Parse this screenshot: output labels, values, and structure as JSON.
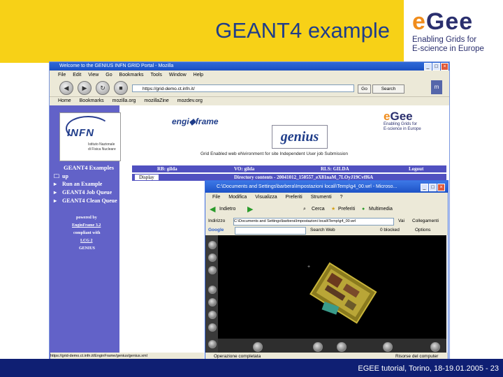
{
  "slide": {
    "title": "GEANT4 example",
    "footer": "EGEE tutorial, Torino, 18-19.01.2005  -  23",
    "logo_word": "eGee",
    "logo_tag_1": "Enabling Grids for",
    "logo_tag_2": "E-science in Europe"
  },
  "browser": {
    "title": "Welcome to the GENIUS INFN GRID Portal - Mozilla",
    "menu": [
      "File",
      "Edit",
      "View",
      "Go",
      "Bookmarks",
      "Tools",
      "Window",
      "Help"
    ],
    "url": "https://grid-demo.ct.infn.it/",
    "go_label": "Go",
    "search_label": "Search",
    "bookmarks": [
      "Home",
      "Bookmarks",
      "mozilla.org",
      "mozillaZine",
      "mozdev.org"
    ],
    "status_url": "https://grid-demo.ct.infn.it/EnginFrame/genius/genius.xml"
  },
  "portal": {
    "infn_label": "INFN",
    "infn_sub_1": "Istituto Nazionale",
    "infn_sub_2": "di Fisica Nucleare",
    "engine_logo": "engi◆frame",
    "genius_logo": "genius",
    "egee_sub_1": "Enabling Grids for",
    "egee_sub_2": "E-science in Europe",
    "tagline": "Grid Enabled web eNvironment for site Independent User job Submission",
    "menu_title": "GEANT4 Examples",
    "menu_items": [
      "up",
      "Run an Example",
      "GEANT4 Job Queue",
      "GEANT4 Clean Queue"
    ],
    "powered_1": "powered by",
    "powered_2": "EnginFrame 3.2",
    "powered_3": "compliant with",
    "powered_4": "LCG 2",
    "powered_5": "GENIUS",
    "bar_rb": "RB: gilda",
    "bar_vo": "VO: gilda",
    "bar_rls": "RLS: GILDA",
    "bar_logout": "Logout",
    "display_btn": "Display",
    "dir_contents": "Directory contents - 20041012_150557_eX81naM_7LOyJ19Cvff6A"
  },
  "viewer_window": {
    "title": "C:\\Documents and Settings\\barbera\\Impostazioni locali\\Temp\\g4_00.wrl - Microso...",
    "menu": [
      "File",
      "Modifica",
      "Visualizza",
      "Preferiti",
      "Strumenti",
      "?"
    ],
    "back_label": "Indietro",
    "search_label": "Cerca",
    "favorites_label": "Preferiti",
    "media_label": "Multimedia",
    "address_label": "Indirizzo",
    "address_value": "C:\\Documents and Settings\\barbera\\Impostazioni locali\\Temp\\g4_00.wrl",
    "go_label": "Vai",
    "links_label": "Collegamenti",
    "google_label": "Google",
    "search_web": "Search Web",
    "popup_label": "0 blocked",
    "options_label": "Options",
    "status_left": "Operazione completata",
    "status_right": "Risorse del computer"
  }
}
